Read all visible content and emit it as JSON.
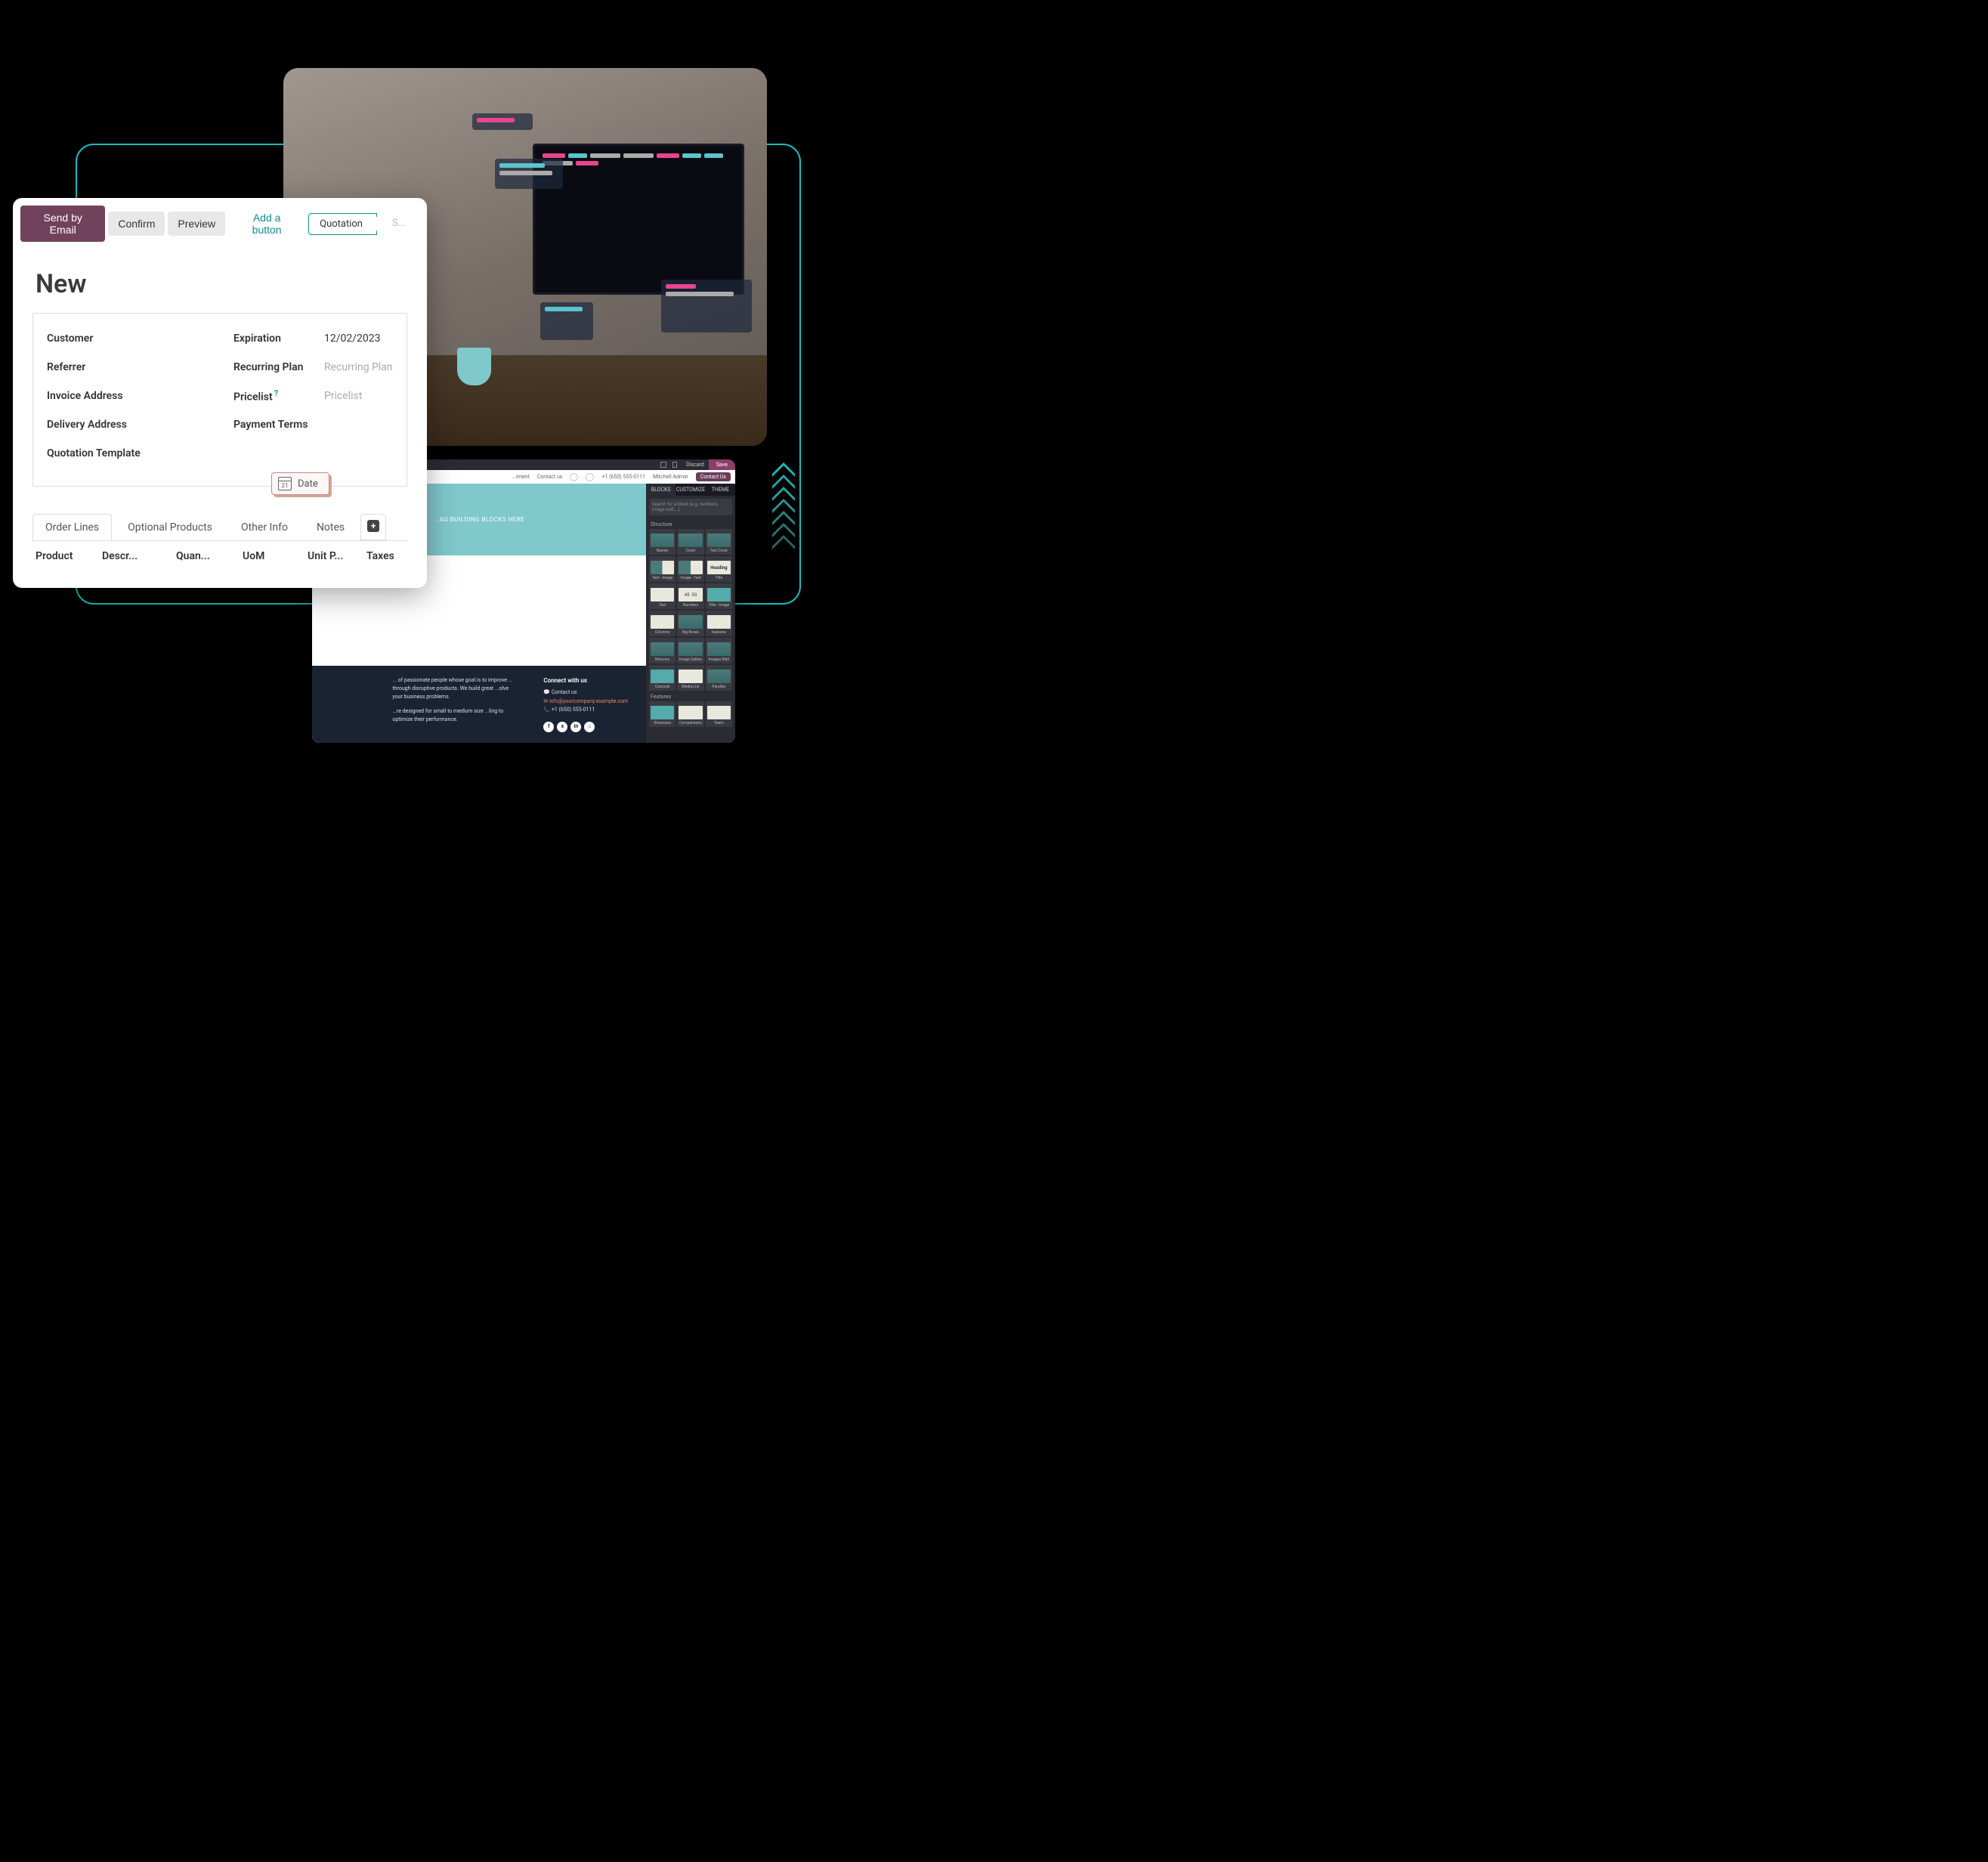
{
  "quotation": {
    "buttons": {
      "send_email": "Send by Email",
      "confirm": "Confirm",
      "preview": "Preview",
      "add_button": "Add a button"
    },
    "status": {
      "active": "Quotation",
      "next": "S..."
    },
    "title": "New",
    "fields": {
      "customer_label": "Customer",
      "referrer_label": "Referrer",
      "invoice_address_label": "Invoice Address",
      "delivery_address_label": "Delivery Address",
      "quotation_template_label": "Quotation Template",
      "expiration_label": "Expiration",
      "expiration_value": "12/02/2023",
      "recurring_plan_label": "Recurring Plan",
      "recurring_plan_placeholder": "Recurring Plan",
      "pricelist_label": "Pricelist",
      "pricelist_placeholder": "Pricelist",
      "payment_terms_label": "Payment Terms"
    },
    "date_badge": {
      "label": "Date",
      "day": "21"
    },
    "tabs": {
      "order_lines": "Order Lines",
      "optional_products": "Optional Products",
      "other_info": "Other Info",
      "notes": "Notes"
    },
    "columns": {
      "product": "Product",
      "description": "Descr...",
      "quantity": "Quan...",
      "uom": "UoM",
      "unit_price": "Unit P...",
      "taxes": "Taxes"
    }
  },
  "website": {
    "toolbar": {
      "discard": "Discard",
      "save": "Save"
    },
    "nav": {
      "item1": "...iment",
      "contact_us": "Contact us",
      "phone": "+1 (650) 555-0111",
      "user": "Mitchell Admin",
      "contact_btn": "Contact Us"
    },
    "side_tabs": {
      "blocks": "BLOCKS",
      "customize": "CUSTOMIZE",
      "theme": "THEME"
    },
    "search_placeholder": "Search for a block (e.g. numbers, image wall,...)",
    "section_structure": "Structure",
    "section_features": "Features",
    "blocks": {
      "banner": "Banner",
      "cover": "Cover",
      "text_cover": "Text Cover",
      "text_image": "Text - Image",
      "image_text": "Image - Text",
      "title": "Title",
      "text": "Text",
      "numbers": "Numbers",
      "title_image": "Title - Image",
      "columns": "Columns",
      "big_boxes": "Big Boxes",
      "features": "Features",
      "masonry": "Masonry",
      "image_gallery": "Image Gallery",
      "images_wall": "Images Wall",
      "carousel": "Carousel",
      "media_list": "Media List",
      "parallax": "Parallax",
      "showcase": "Showcase",
      "comparisons": "Comparisons",
      "team": "Team"
    },
    "drag_hint": "...AG BUILDING BLOCKS HERE",
    "footer": {
      "about_text": "... of passionate people whose goal is to improve ... through disruptive products. We build great ...olve your business problems.",
      "about_text2": "...re designed for small to medium size ...ling to optimize their performance.",
      "connect_title": "Connect with us",
      "contact_us": "Contact us",
      "email": "info@yourcompany.example.com",
      "phone": "+1 (650) 555-0111"
    },
    "social": {
      "f": "f",
      "x": "x",
      "in": "in",
      "home": "⌂"
    },
    "heading_thumb": "Heading",
    "numbers_thumb_a": "45",
    "numbers_thumb_b": "93"
  }
}
